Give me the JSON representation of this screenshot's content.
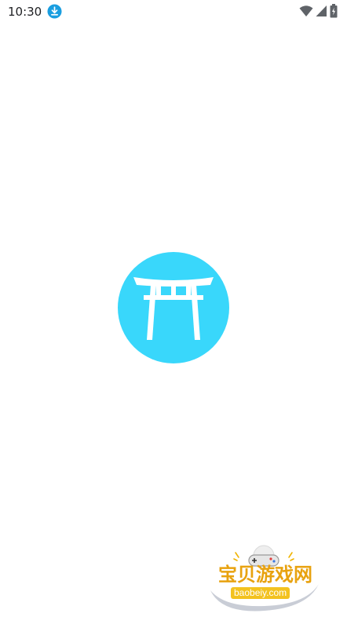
{
  "status_bar": {
    "time": "10:30",
    "icons": [
      "download-icon",
      "wifi-icon",
      "cell-signal-icon",
      "battery-icon"
    ]
  },
  "splash": {
    "logo_icon": "torii-gate-icon",
    "logo_color": "#39d7fb"
  },
  "watermark": {
    "brand": "宝贝游戏网",
    "domain": "baobeiy.com",
    "brand_color": "#e8a20f",
    "domain_bg": "#f3c21f"
  }
}
